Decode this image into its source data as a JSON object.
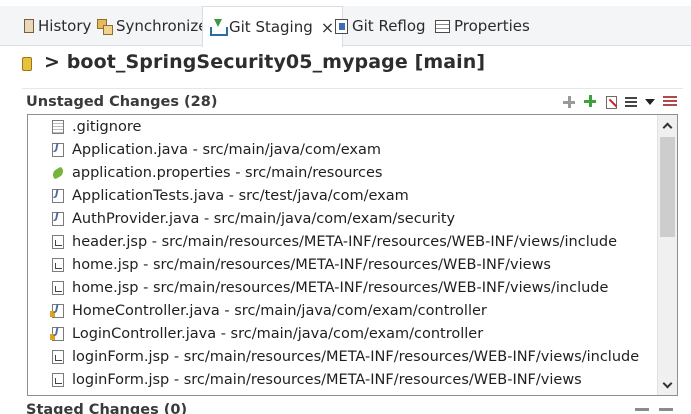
{
  "tabs": [
    {
      "label": "History",
      "icon": "history-icon"
    },
    {
      "label": "Synchronize",
      "icon": "synchronize-icon"
    },
    {
      "label": "Git Staging",
      "icon": "git-staging-icon",
      "active": true
    },
    {
      "label": "Git Reflog",
      "icon": "git-reflog-icon"
    },
    {
      "label": "Properties",
      "icon": "properties-icon"
    }
  ],
  "tab_close_glyph": "×",
  "title": "> boot_SpringSecurity05_mypage [main]",
  "unstaged": {
    "title": "Unstaged Changes (28)",
    "files": [
      {
        "label": ".gitignore",
        "type": "text"
      },
      {
        "label": "Application.java - src/main/java/com/exam",
        "type": "java"
      },
      {
        "label": "application.properties - src/main/resources",
        "type": "prop"
      },
      {
        "label": "ApplicationTests.java - src/test/java/com/exam",
        "type": "java"
      },
      {
        "label": "AuthProvider.java - src/main/java/com/exam/security",
        "type": "java"
      },
      {
        "label": "header.jsp - src/main/resources/META-INF/resources/WEB-INF/views/include",
        "type": "jsp"
      },
      {
        "label": "home.jsp - src/main/resources/META-INF/resources/WEB-INF/views",
        "type": "jsp"
      },
      {
        "label": "home.jsp - src/main/resources/META-INF/resources/WEB-INF/views/include",
        "type": "jsp"
      },
      {
        "label": "HomeController.java - src/main/java/com/exam/controller",
        "type": "ctrl"
      },
      {
        "label": "LoginController.java - src/main/java/com/exam/controller",
        "type": "ctrl"
      },
      {
        "label": "loginForm.jsp - src/main/resources/META-INF/resources/WEB-INF/views/include",
        "type": "jsp"
      },
      {
        "label": "loginForm.jsp - src/main/resources/META-INF/resources/WEB-INF/views",
        "type": "jsp"
      }
    ]
  },
  "staged": {
    "title": "Staged Changes (0)"
  }
}
